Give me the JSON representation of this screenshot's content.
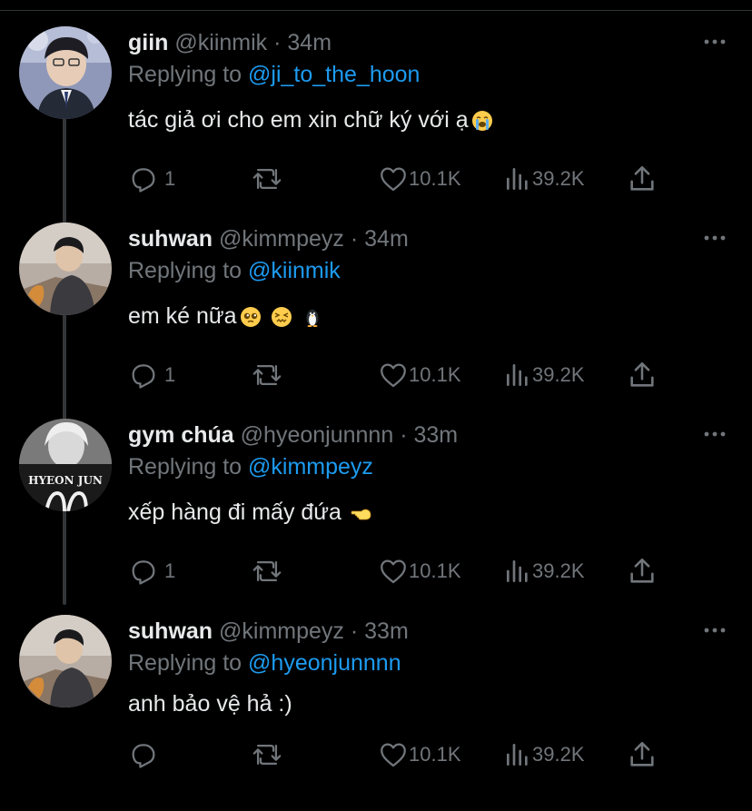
{
  "tweets": [
    {
      "name": "giin",
      "handle": "@kiinmik",
      "sep": "·",
      "time": "34m",
      "replying_prefix": "Replying to",
      "replying_to": "@ji_to_the_hoon",
      "text": "tác giả ơi cho em xin chữ ký với ạ",
      "emojis": [
        "loudly-crying-face-emoji"
      ],
      "replies": "1",
      "likes": "10.1K",
      "views": "39.2K"
    },
    {
      "name": "suhwan",
      "handle": "@kimmpeyz",
      "sep": "·",
      "time": "34m",
      "replying_prefix": "Replying to",
      "replying_to": "@kiinmik",
      "text": "em ké nữa",
      "emojis": [
        "pleading-face-emoji",
        "confounded-face-emoji",
        "penguin-emoji"
      ],
      "replies": "1",
      "likes": "10.1K",
      "views": "39.2K"
    },
    {
      "name": "gym chúa",
      "handle": "@hyeonjunnnn",
      "sep": "·",
      "time": "33m",
      "replying_prefix": "Replying to",
      "replying_to": "@kimmpeyz",
      "text": "xếp hàng đi mấy đứa",
      "emojis": [
        "backhand-index-pointing-left-emoji"
      ],
      "avatar_caption": "HYEON JUN",
      "replies": "1",
      "likes": "10.1K",
      "views": "39.2K"
    },
    {
      "name": "suhwan",
      "handle": "@kimmpeyz",
      "sep": "·",
      "time": "33m",
      "replying_prefix": "Replying to",
      "replying_to": "@hyeonjunnnn",
      "text": "anh bảo vệ hả :)",
      "emojis": [],
      "replies": "",
      "likes": "10.1K",
      "views": "39.2K"
    }
  ],
  "colors": {
    "background": "#000000",
    "primary_text": "#e7e9ea",
    "secondary_text": "#71767b",
    "link": "#1d9bf0",
    "thread_line": "#333639"
  },
  "icons": [
    "reply-icon",
    "retweet-icon",
    "like-icon",
    "views-icon",
    "share-icon",
    "more-options-icon"
  ]
}
